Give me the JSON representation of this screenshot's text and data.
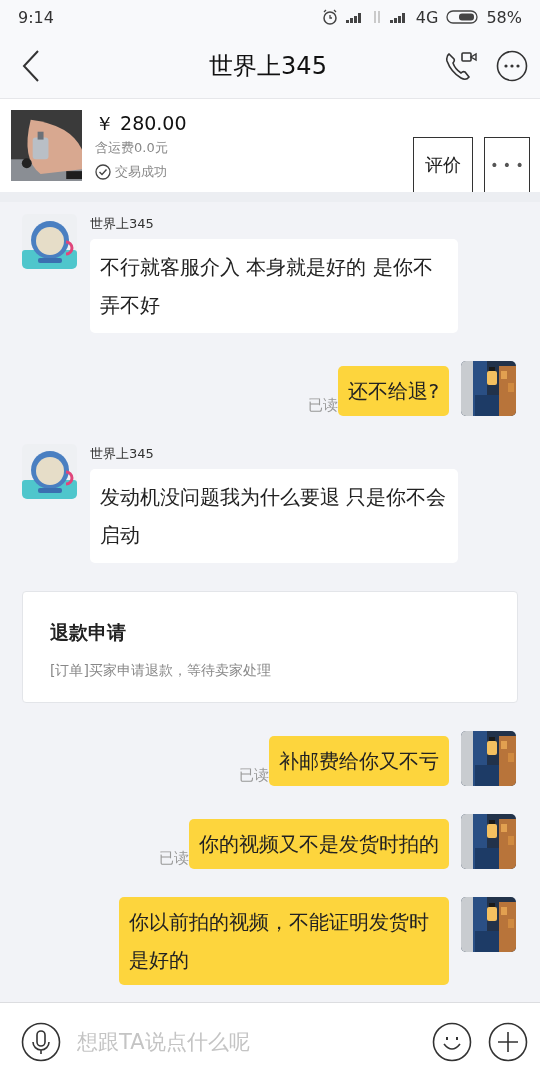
{
  "status_bar": {
    "time": "9:14",
    "network": "4G",
    "battery": "58%"
  },
  "header": {
    "title": "世界上345"
  },
  "order": {
    "price": "￥ 280.00",
    "shipping": "含运费0.0元",
    "status": "交易成功",
    "buttons": [
      "评价",
      "• • •"
    ]
  },
  "messages": [
    {
      "kind": "incoming",
      "sender": "世界上345",
      "text": "不行就客服介入 本身就是好的 是你不弄不好"
    },
    {
      "kind": "outgoing",
      "text": "还不给退?",
      "read_label": "已读"
    },
    {
      "kind": "incoming",
      "sender": "世界上345",
      "text": "发动机没问题我为什么要退 只是你不会启动"
    },
    {
      "kind": "refund",
      "title": "退款申请",
      "text": "[订单]买家申请退款，等待卖家处理"
    },
    {
      "kind": "outgoing",
      "text": "补邮费给你又不亏",
      "read_label": "已读"
    },
    {
      "kind": "outgoing",
      "text": "你的视频又不是发货时拍的",
      "read_label": "已读"
    },
    {
      "kind": "outgoing",
      "text": "你以前拍的视频，不能证明发货时是好的"
    }
  ],
  "input": {
    "placeholder": "想跟TA说点什么呢"
  }
}
